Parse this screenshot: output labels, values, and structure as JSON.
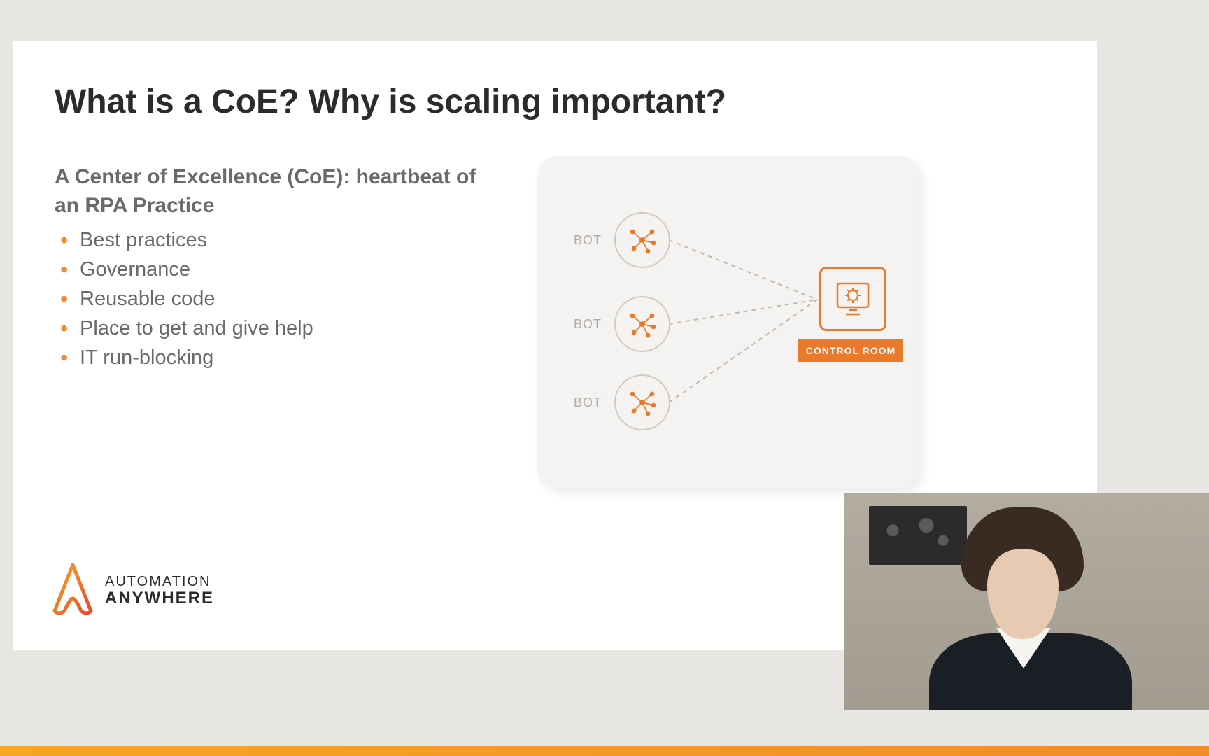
{
  "slide": {
    "title": "What is a CoE? Why is scaling important?",
    "subtitle": "A Center of Excellence (CoE): heartbeat of an RPA Practice",
    "bullets": [
      "Best practices",
      "Governance",
      "Reusable code",
      "Place to get and give help",
      "IT run-blocking"
    ]
  },
  "diagram": {
    "bot_label": "BOT",
    "control_label": "CONTROL ROOM"
  },
  "brand": {
    "line1": "AUTOMATION",
    "line2": "ANYWHERE"
  },
  "colors": {
    "accent": "#e9792b"
  }
}
